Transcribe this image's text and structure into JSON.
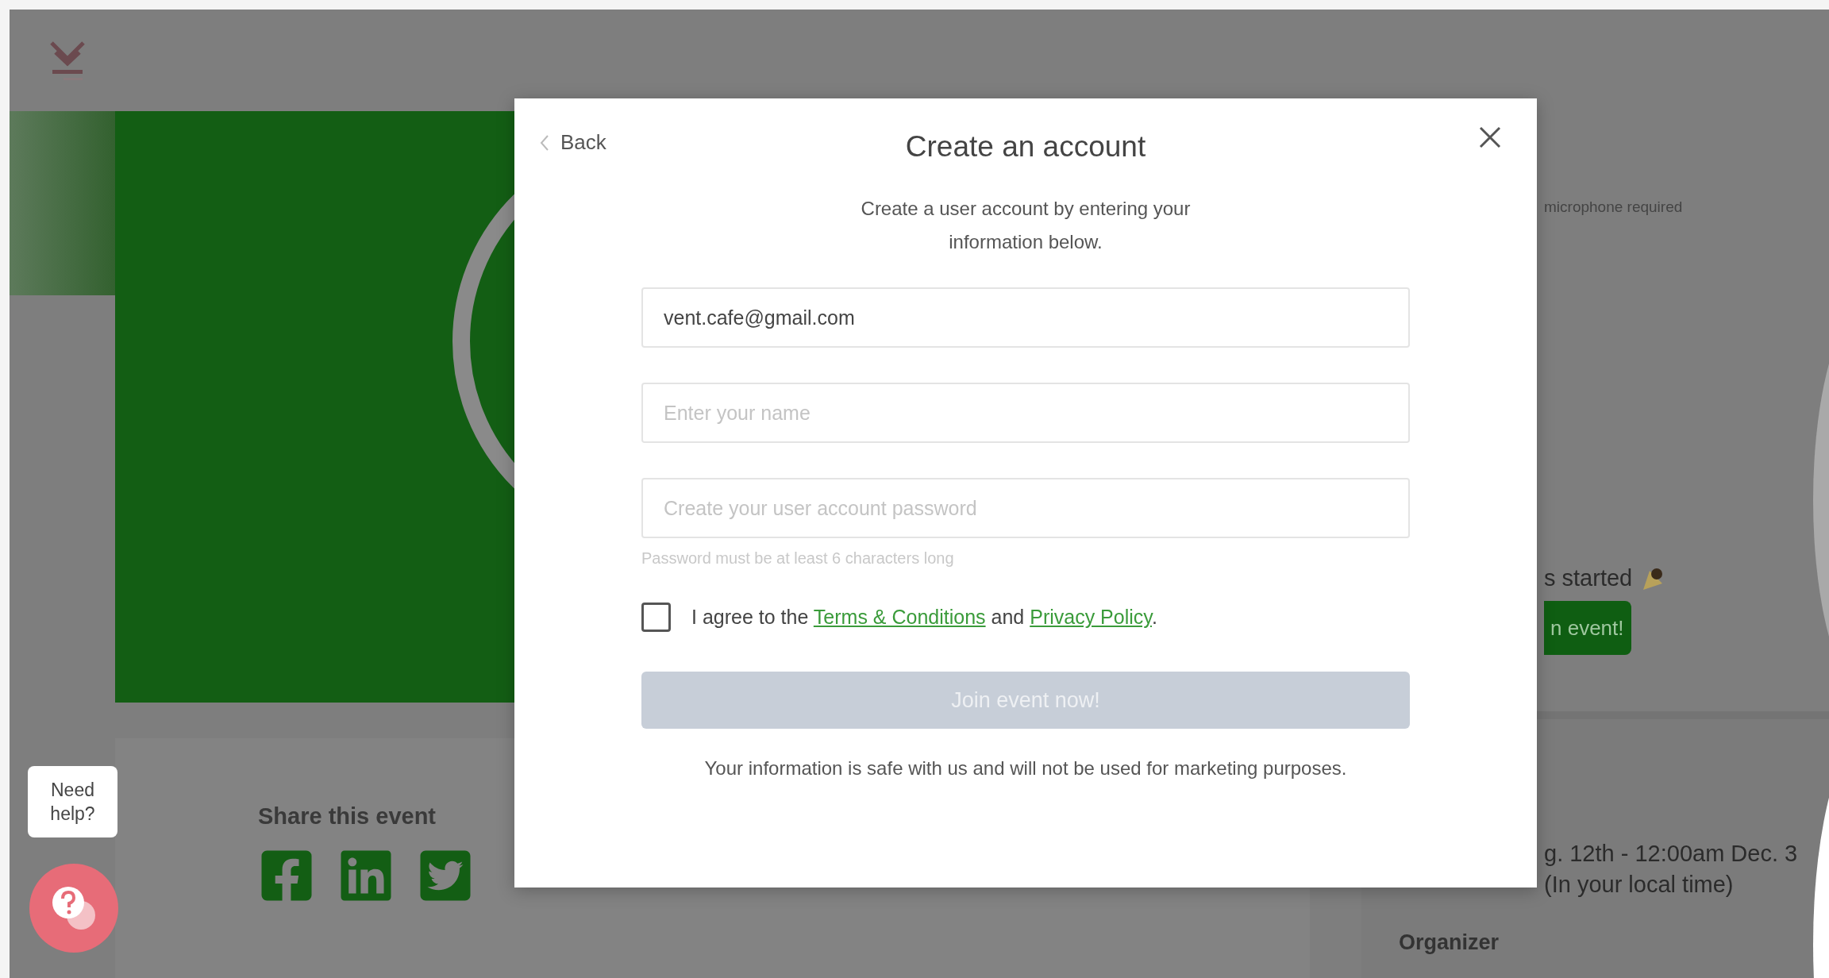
{
  "event_info": {
    "requirement_text": "microphone required",
    "status_text": "s started",
    "join_button": "n event!",
    "date_text": "g. 12th - 12:00am Dec. 3",
    "timezone_text": "(In your local time)",
    "organizer_label": "Organizer"
  },
  "share": {
    "title": "Share this event"
  },
  "help": {
    "bubble": "Need help?"
  },
  "modal": {
    "back": "Back",
    "title": "Create an account",
    "subtitle": "Create a user account by entering your information below.",
    "fields": [
      {
        "value": "vent.cafe@gmail.com"
      },
      {
        "placeholder": "Enter your name"
      },
      {
        "placeholder": "Create your user account password",
        "hint": "Password must be at least 6 characters long"
      }
    ],
    "agree": {
      "checked": false,
      "prefix": "I agree to the",
      "terms": "Terms & Conditions",
      "middle": "and",
      "privacy": "Privacy Policy",
      "suffix": "."
    },
    "submit": {
      "label": "Join event now!",
      "disabled": true
    },
    "footer": "Your information is safe with us and will not be used for marketing purposes."
  }
}
